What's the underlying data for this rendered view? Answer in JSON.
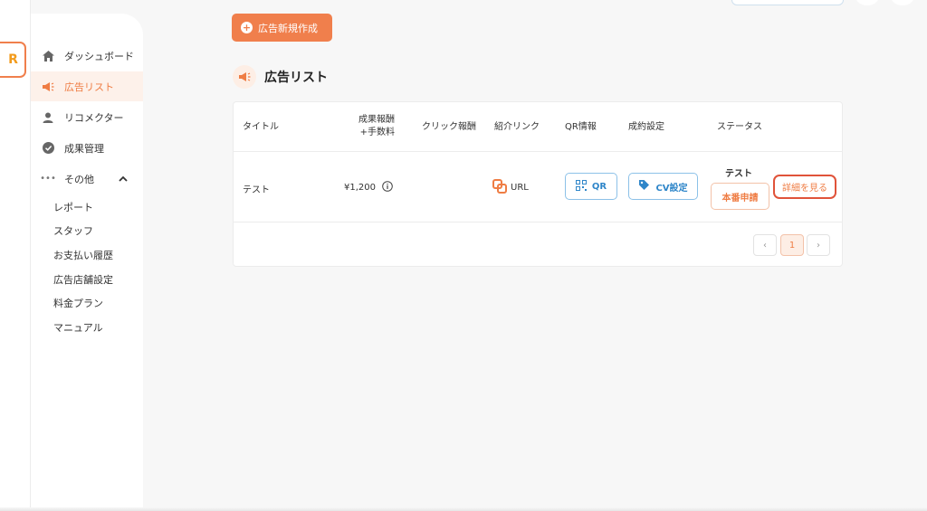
{
  "brand": {
    "logo_letter": "R",
    "accent": "#f07f4c",
    "danger_outline": "#e0533a",
    "link_blue": "#2f86c9"
  },
  "sidebar": {
    "items": [
      {
        "label": "ダッシュボード",
        "icon": "home-icon"
      },
      {
        "label": "広告リスト",
        "icon": "megaphone-icon",
        "active": true
      },
      {
        "label": "リコメクター",
        "icon": "user-icon"
      },
      {
        "label": "成果管理",
        "icon": "check-circle-icon"
      },
      {
        "label": "その他",
        "icon": "more-dots-icon",
        "expanded": true
      }
    ],
    "sub_items": [
      "レポート",
      "スタッフ",
      "お支払い履歴",
      "広告店舗設定",
      "料金プラン",
      "マニュアル"
    ]
  },
  "toolbar": {
    "new_ad_label": "広告新規作成"
  },
  "page": {
    "title": "広告リスト"
  },
  "table": {
    "headers": {
      "title": "タイトル",
      "reward_line1": "成果報酬",
      "reward_line2": "+手数料",
      "click_reward": "クリック報酬",
      "referral_link": "紹介リンク",
      "qr_info": "QR情報",
      "conversion_settings": "成約設定",
      "status": "ステータス"
    },
    "rows": [
      {
        "title": "テスト",
        "reward": "¥1,200",
        "click_reward": "",
        "link_label": "URL",
        "qr_label": "QR",
        "cv_label": "CV設定",
        "status": "テスト",
        "apply_label": "本番申請",
        "detail_label": "詳細を見る"
      }
    ]
  },
  "pagination": {
    "prev": "‹",
    "current": "1",
    "next": "›"
  }
}
